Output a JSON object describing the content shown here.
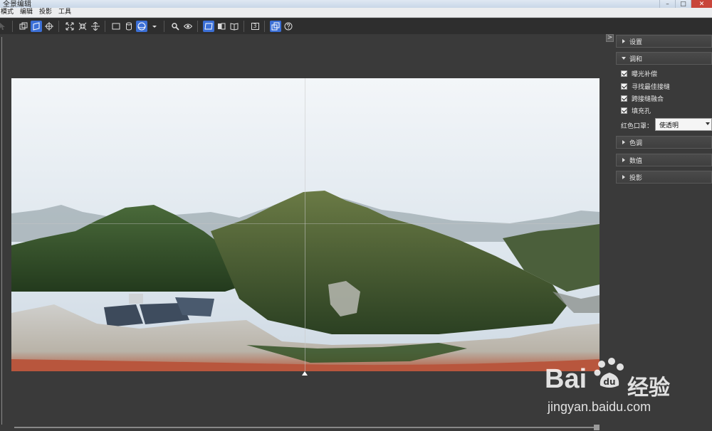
{
  "window": {
    "title": "全景编辑",
    "controls": [
      "–",
      "□",
      "✕"
    ]
  },
  "menubar": {
    "items": [
      "模式",
      "编辑",
      "投影",
      "工具"
    ]
  },
  "toolbar": {
    "buttons": [
      {
        "icon": "select-arrow-icon"
      },
      {
        "icon": "mode-overlay-icon"
      },
      {
        "icon": "mode-warp-icon",
        "active": true
      },
      {
        "icon": "crosshair-center-icon"
      },
      {
        "icon": "fit-expand-icon"
      },
      {
        "icon": "fit-contract-icon"
      },
      {
        "icon": "straighten-icon"
      },
      {
        "icon": "rectilinear-projection-icon"
      },
      {
        "icon": "cylindrical-projection-icon"
      },
      {
        "icon": "spherical-projection-icon",
        "active": true
      },
      {
        "icon": "projection-dropdown-icon"
      },
      {
        "icon": "zoom-icon"
      },
      {
        "icon": "preview-eye-icon"
      },
      {
        "icon": "view-plane-icon",
        "active": true
      },
      {
        "icon": "view-half-icon"
      },
      {
        "icon": "view-book-icon"
      },
      {
        "icon": "number-3-icon",
        "text": "3"
      },
      {
        "icon": "overlay-windows-icon",
        "active": true
      },
      {
        "icon": "help-icon"
      }
    ]
  },
  "panel": {
    "collapse_glyph": ">",
    "sections": {
      "settings": "设置",
      "blend": "调和",
      "tone": "色调",
      "values": "数值",
      "projection": "投影"
    },
    "checkboxes": [
      {
        "label": "曝光补偿",
        "checked": true
      },
      {
        "label": "寻找最佳接缝",
        "checked": true
      },
      {
        "label": "跨接缝融合",
        "checked": true
      },
      {
        "label": "填充孔",
        "checked": true
      }
    ],
    "red_mask": {
      "label": "红色口罩：",
      "value": "使透明"
    }
  },
  "watermark": {
    "brand": "Bai",
    "product": "经验",
    "url": "jingyan.baidu.com"
  },
  "colors": {
    "accent": "#3b6fd6",
    "background": "#3a3a3a",
    "toolbar": "#2e2e2e"
  }
}
